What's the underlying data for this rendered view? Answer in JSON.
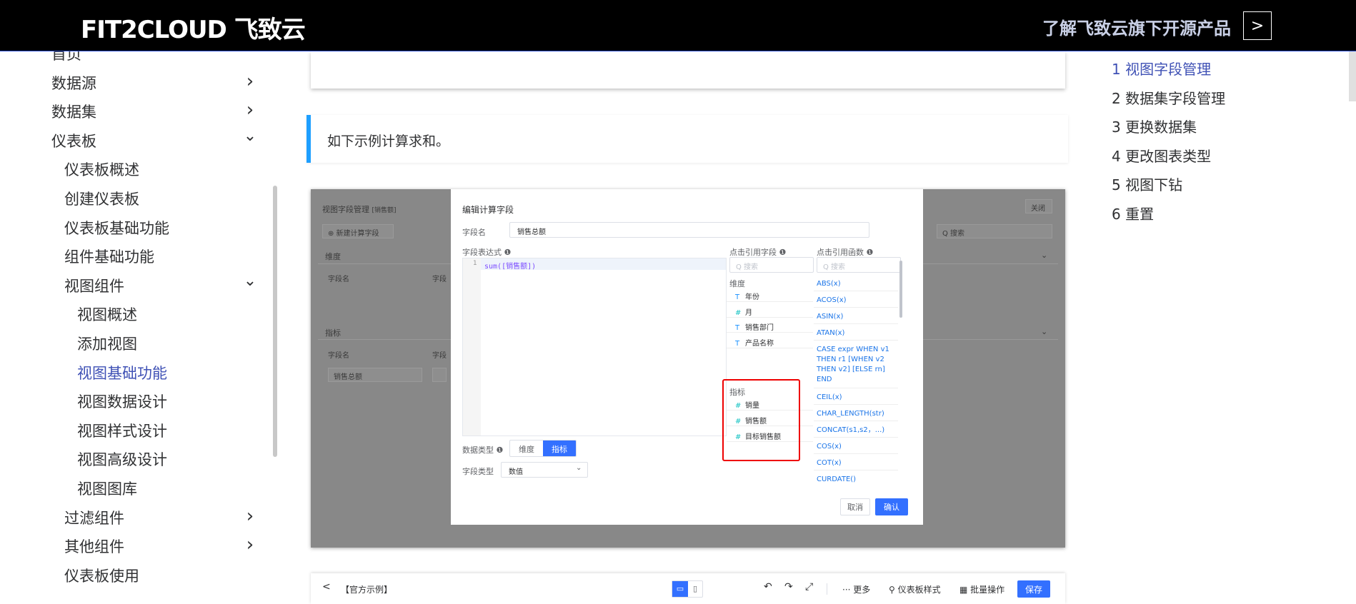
{
  "header": {
    "logo": "FIT2CLOUD 飞致云",
    "link": "了解飞致云旗下开源产品",
    "arrow": ">"
  },
  "nav": {
    "items": [
      {
        "label": "首页",
        "level": 0
      },
      {
        "label": "数据源",
        "level": 0,
        "chevron": ">"
      },
      {
        "label": "数据集",
        "level": 0,
        "chevron": ">"
      },
      {
        "label": "仪表板",
        "level": 0,
        "chevron": "v"
      },
      {
        "label": "仪表板概述",
        "level": 1
      },
      {
        "label": "创建仪表板",
        "level": 1
      },
      {
        "label": "仪表板基础功能",
        "level": 1
      },
      {
        "label": "组件基础功能",
        "level": 1
      },
      {
        "label": "视图组件",
        "level": 1,
        "chevron": "v"
      },
      {
        "label": "视图概述",
        "level": 2
      },
      {
        "label": "添加视图",
        "level": 2
      },
      {
        "label": "视图基础功能",
        "level": 2,
        "active": true
      },
      {
        "label": "视图数据设计",
        "level": 2
      },
      {
        "label": "视图样式设计",
        "level": 2
      },
      {
        "label": "视图高级设计",
        "level": 2
      },
      {
        "label": "视图图库",
        "level": 2
      },
      {
        "label": "过滤组件",
        "level": 1,
        "chevron": ">"
      },
      {
        "label": "其他组件",
        "level": 1,
        "chevron": ">"
      },
      {
        "label": "仪表板使用",
        "level": 1
      }
    ]
  },
  "content": {
    "note": "如下示例计算求和。"
  },
  "screenshot": {
    "bg": {
      "title": "视图字段管理",
      "title_sub": "[销售额]",
      "close": "关闭",
      "new_calc": "⊕ 新建计算字段",
      "search": "Q 搜索",
      "dimension": "维度",
      "metric": "指标",
      "col_field": "字段名",
      "col_field2": "字段",
      "row_value": "销售总额"
    },
    "modal": {
      "title": "编辑计算字段",
      "field_name_label": "字段名",
      "field_name_value": "销售总额",
      "expr_label": "字段表达式 ❶",
      "code_line_no": "1",
      "code": "sum([销售额])",
      "ref_field_label": "点击引用字段 ❶",
      "ref_func_label": "点击引用函数 ❶",
      "search_placeholder": "Q 搜索",
      "dim_group": "维度",
      "metric_group": "指标",
      "dimensions": [
        {
          "icon": "T",
          "name": "年份"
        },
        {
          "icon": "#",
          "name": "月"
        },
        {
          "icon": "T",
          "name": "销售部门"
        },
        {
          "icon": "T",
          "name": "产品名称"
        }
      ],
      "metrics": [
        {
          "icon": "#",
          "name": "销量"
        },
        {
          "icon": "#",
          "name": "销售额"
        },
        {
          "icon": "#",
          "name": "目标销售额"
        }
      ],
      "functions": [
        "ABS(x)",
        "ACOS(x)",
        "ASIN(x)",
        "ATAN(x)",
        "CASE expr WHEN v1 THEN r1 [WHEN v2 THEN v2] [ELSE rn] END",
        "CEIL(x)",
        "CHAR_LENGTH(str)",
        "CONCAT(s1,s2，...)",
        "COS(x)",
        "COT(x)",
        "CURDATE()"
      ],
      "data_type_label": "数据类型 ❶",
      "data_type_options": [
        "维度",
        "指标"
      ],
      "field_type_label": "字段类型",
      "field_type_value": "数值",
      "cancel": "取消",
      "confirm": "确认"
    }
  },
  "toolbar": {
    "back": "<",
    "title": "【官方示例】",
    "undo": "↶",
    "redo": "↷",
    "fullscreen": "⤢",
    "more": "··· 更多",
    "style": "仪表板样式",
    "batch": "批量操作",
    "save": "保存"
  },
  "toc": {
    "items": [
      "1 视图字段管理",
      "2 数据集字段管理",
      "3 更换数据集",
      "4 更改图表类型",
      "5 视图下钻",
      "6 重置"
    ]
  }
}
